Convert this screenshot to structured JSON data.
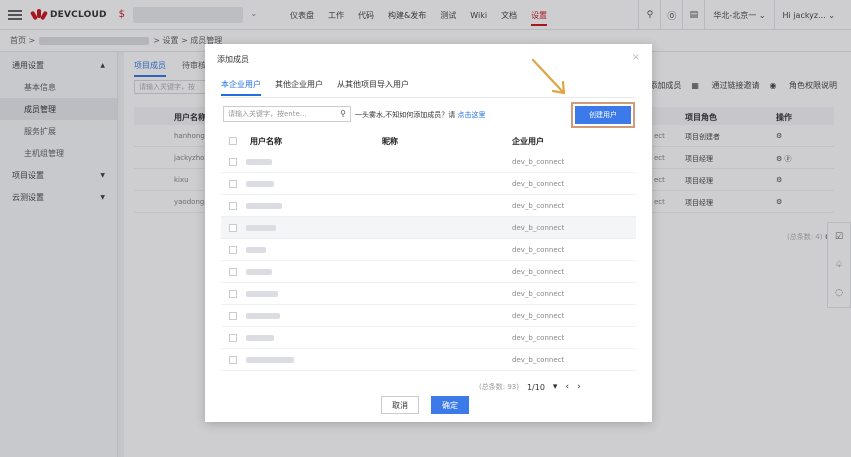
{
  "topbar": {
    "logo_text": "DEVCLOUD",
    "nav": [
      "仪表盘",
      "工作",
      "代码",
      "构建&发布",
      "测试",
      "Wiki",
      "文档",
      "设置"
    ],
    "nav_active_index": 7,
    "region": "华北-北京一",
    "user": "Hi jackyz...",
    "accent_color": "#c7000b"
  },
  "breadcrumb": {
    "home": "首页 >",
    "rest": "> 设置 > 成员管理"
  },
  "sidebar": {
    "groups": [
      {
        "label": "通用设置",
        "chevron": "▲"
      },
      {
        "label": "项目设置",
        "chevron": "▼"
      },
      {
        "label": "云测设置",
        "chevron": "▼"
      }
    ],
    "items": [
      "基本信息",
      "成员管理",
      "服务扩展",
      "主机组管理"
    ],
    "active_item": "成员管理"
  },
  "main": {
    "tabs": [
      "项目成员",
      "待审核"
    ],
    "search_placeholder": "请输入关键字，按",
    "actions": [
      "添加成员",
      "通过链接邀请",
      "角色权限说明"
    ],
    "headers": [
      "用户名称",
      "项目角色",
      "操作"
    ],
    "rows": [
      {
        "name": "hanhong",
        "suffix": "ect",
        "role": "项目创建者",
        "op": "⚙"
      },
      {
        "name": "jackyzhou",
        "suffix": "ect",
        "role": "项目经理",
        "op": "⚙ ⓟ"
      },
      {
        "name": "kixu",
        "suffix": "ect",
        "role": "项目经理",
        "op": "⚙"
      },
      {
        "name": "yaodong",
        "suffix": "ect",
        "role": "项目经理",
        "op": "⚙"
      }
    ],
    "total_text": "(总条数: 4)"
  },
  "modal": {
    "title": "添加成员",
    "close": "×",
    "tabs": [
      "本企业用户",
      "其他企业用户",
      "从其他项目导入用户"
    ],
    "active_tab": 0,
    "search_placeholder": "请输入关键字，按ente...",
    "hint_prefix": "一头雾水,不知如何添加成员？请",
    "hint_link": "点击这里",
    "create_button": "创建用户",
    "headers": {
      "name": "用户名称",
      "nick": "昵称",
      "ent": "企业用户"
    },
    "rows": [
      {
        "ent": "dev_b_connect"
      },
      {
        "ent": "dev_b_connect"
      },
      {
        "ent": "dev_b_connect"
      },
      {
        "ent": "dev_b_connect"
      },
      {
        "ent": "dev_b_connect"
      },
      {
        "ent": "dev_b_connect"
      },
      {
        "ent": "dev_b_connect"
      },
      {
        "ent": "dev_b_connect"
      },
      {
        "ent": "dev_b_connect"
      },
      {
        "ent": "dev_b_connect"
      }
    ],
    "pager": {
      "total": "(总条数: 93)",
      "page": "1/10",
      "dropdown": "▾",
      "prev": "‹",
      "next": "›"
    },
    "cancel": "取消",
    "ok": "确定"
  }
}
